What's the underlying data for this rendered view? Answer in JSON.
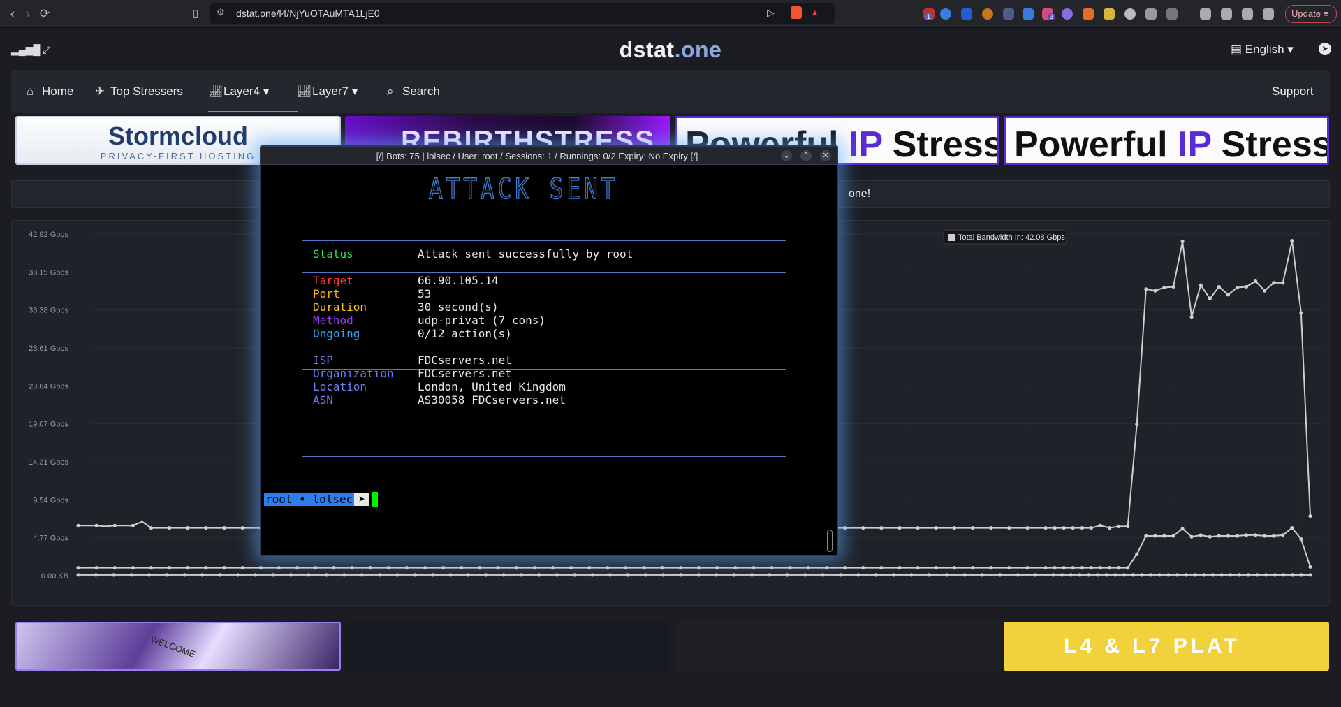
{
  "browser": {
    "url": "dstat.one/l4/NjYuOTAuMTA1LjE0",
    "update_label": "Update",
    "badge_a": "1",
    "badge_b": "3"
  },
  "site": {
    "logo_main": "dstat",
    "logo_accent": ".one",
    "language": "English",
    "nav": {
      "home": "Home",
      "top_stressers": "Top Stressers",
      "layer4": "Layer4",
      "layer7": "Layer7",
      "search": "Search",
      "support": "Support"
    },
    "notice_fragment": "one!"
  },
  "ads_top": {
    "stormcloud_title": "Stormcloud",
    "stormcloud_sub": "PRIVACY-FIRST HOSTING",
    "rebirth": "REBIRTHSTRESS",
    "powerful_1a": "Powerful ",
    "powerful_1b": "IP",
    "powerful_1c": " Stresser",
    "powerful_2a": "Powerful ",
    "powerful_2b": "IP",
    "powerful_2c": " Stresser"
  },
  "ads_bottom": {
    "welcome": "WELCOME",
    "platform": "L4 & L7 PLAT"
  },
  "chart_data": {
    "type": "line",
    "y_ticks": [
      "42.92 Gbps",
      "38.15 Gbps",
      "33.38 Gbps",
      "28.61 Gbps",
      "23.84 Gbps",
      "19.07 Gbps",
      "14.31 Gbps",
      "9.54 Gbps",
      "4.77 Gbps",
      "0.00 KB"
    ],
    "ylim": [
      0,
      42.92
    ],
    "y_unit": "Gbps",
    "tooltip": "Total Bandwidth In: 42.08 Gbps",
    "series": [
      {
        "name": "Total Bandwidth In",
        "color": "#cfcfcf",
        "values": [
          6.3,
          6.3,
          6.3,
          6.2,
          6.3,
          6.3,
          6.3,
          6.8,
          6.0,
          6.0,
          6.0,
          6.0,
          6.0,
          6.0,
          6.0,
          6.0,
          6.0,
          6.0,
          6.0,
          6.0,
          6.0,
          6.0,
          6.0,
          6.0,
          6.0,
          6.0,
          6.0,
          6.0,
          6.0,
          6.0,
          6.0,
          6.0,
          6.0,
          6.0,
          6.0,
          6.0,
          6.0,
          6.0,
          6.0,
          6.0,
          6.0,
          6.0,
          6.0,
          6.0,
          6.0,
          6.0,
          6.0,
          6.0,
          6.0,
          6.0,
          6.0,
          6.0,
          6.0,
          6.0,
          6.0,
          6.0,
          6.0,
          6.0,
          6.0,
          6.0,
          6.0,
          6.0,
          6.0,
          6.0,
          6.0,
          6.0,
          6.0,
          6.0,
          6.0,
          6.0,
          6.0,
          6.0,
          6.0,
          6.0,
          6.0,
          6.0,
          6.0,
          6.0,
          6.0,
          6.0,
          6.0,
          6.0,
          6.0,
          6.0,
          6.0,
          6.0,
          6.0,
          6.0,
          6.0,
          6.0,
          6.0,
          6.0,
          6.0,
          6.0,
          6.0,
          6.0,
          6.0,
          6.0,
          6.0,
          6.0,
          6.0,
          6.0,
          6.0,
          6.0,
          6.0,
          6.0,
          6.0,
          6.0,
          6.0,
          6.0,
          6.0,
          6.0,
          6.3,
          6.0,
          6.2,
          6.2,
          19.0,
          36.0,
          35.8,
          36.2,
          36.3,
          42.0,
          32.5,
          36.5,
          34.8,
          36.3,
          35.3,
          36.2,
          36.3,
          37.0,
          35.8,
          36.8,
          36.8,
          42.08,
          33.0,
          7.5
        ]
      },
      {
        "name": "",
        "color": "#cfcfcf",
        "values": [
          1.0,
          1.0,
          1.0,
          1.0,
          1.0,
          1.0,
          1.0,
          1.0,
          1.0,
          1.0,
          1.0,
          1.0,
          1.0,
          1.0,
          1.0,
          1.0,
          1.0,
          1.0,
          1.0,
          1.0,
          1.0,
          1.0,
          1.0,
          1.0,
          1.0,
          1.0,
          1.0,
          1.0,
          1.0,
          1.0,
          1.0,
          1.0,
          1.0,
          1.0,
          1.0,
          1.0,
          1.0,
          1.0,
          1.0,
          1.0,
          1.0,
          1.0,
          1.0,
          1.0,
          1.0,
          1.0,
          1.0,
          1.0,
          1.0,
          1.0,
          1.0,
          1.0,
          1.0,
          1.0,
          1.0,
          1.0,
          1.0,
          1.0,
          1.0,
          1.0,
          1.0,
          1.0,
          1.0,
          1.0,
          1.0,
          1.0,
          1.0,
          1.0,
          1.0,
          1.0,
          1.0,
          1.0,
          1.0,
          1.0,
          1.0,
          1.0,
          1.0,
          1.0,
          1.0,
          1.0,
          1.0,
          1.0,
          1.0,
          1.0,
          1.0,
          1.0,
          1.0,
          1.0,
          1.0,
          1.0,
          1.0,
          1.0,
          1.0,
          1.0,
          1.0,
          1.0,
          1.0,
          1.0,
          1.0,
          1.0,
          1.0,
          1.0,
          1.0,
          1.0,
          1.0,
          1.0,
          1.0,
          1.0,
          1.0,
          1.0,
          1.0,
          1.0,
          1.0,
          1.0,
          1.0,
          1.0,
          2.7,
          5.0,
          5.0,
          5.0,
          5.0,
          5.9,
          4.9,
          5.1,
          4.9,
          5.0,
          5.0,
          5.0,
          5.1,
          5.1,
          5.0,
          5.0,
          5.1,
          6.0,
          4.6,
          1.1
        ]
      },
      {
        "name": "",
        "color": "#cfcfcf",
        "values": [
          0.1,
          0.1,
          0.1,
          0.1,
          0.1,
          0.1,
          0.1,
          0.1,
          0.1,
          0.1,
          0.1,
          0.1,
          0.1,
          0.1,
          0.1,
          0.1,
          0.1,
          0.1,
          0.1,
          0.1,
          0.1,
          0.1,
          0.1,
          0.1,
          0.1,
          0.1,
          0.1,
          0.1,
          0.1,
          0.1,
          0.1,
          0.1,
          0.1,
          0.1,
          0.1,
          0.1,
          0.1,
          0.1,
          0.1,
          0.1,
          0.1,
          0.1,
          0.1,
          0.1,
          0.1,
          0.1,
          0.1,
          0.1,
          0.1,
          0.1,
          0.1,
          0.1,
          0.1,
          0.1,
          0.1,
          0.1,
          0.1,
          0.1,
          0.1,
          0.1,
          0.1,
          0.1,
          0.1,
          0.1,
          0.1,
          0.1,
          0.1,
          0.1,
          0.1,
          0.1,
          0.1,
          0.1,
          0.1,
          0.1,
          0.1,
          0.1,
          0.1,
          0.1,
          0.1,
          0.1,
          0.1,
          0.1,
          0.1,
          0.1,
          0.1,
          0.1,
          0.1,
          0.1,
          0.1,
          0.1,
          0.1,
          0.1,
          0.1,
          0.1,
          0.1,
          0.1,
          0.1,
          0.1,
          0.1,
          0.1,
          0.1,
          0.1,
          0.1,
          0.1,
          0.1,
          0.1,
          0.1,
          0.1,
          0.1,
          0.1,
          0.1,
          0.1,
          0.1,
          0.1,
          0.1,
          0.1,
          0.1,
          0.1,
          0.1,
          0.1,
          0.1,
          0.1,
          0.1,
          0.1,
          0.1,
          0.1,
          0.1,
          0.1,
          0.1,
          0.1,
          0.1,
          0.1,
          0.1,
          0.1,
          0.1,
          0.1,
          0.1,
          0.1,
          0.1,
          0.1
        ]
      }
    ]
  },
  "terminal": {
    "title": "[/] Bots: 75 | lolsec / User: root / Sessions: 1 / Runnings: 0/2 Expiry: No Expiry [/]",
    "banner": "ATTACK SENT",
    "rows": [
      {
        "key": "Status",
        "value": "Attack sent successfully by root",
        "color": "#2fe04a"
      },
      {
        "key": "Target",
        "value": "66.90.105.14",
        "color": "#ff3b3b"
      },
      {
        "key": "Port",
        "value": "53",
        "color": "#ffb21e"
      },
      {
        "key": "Duration",
        "value": "30 second(s)",
        "color": "#ffc21e"
      },
      {
        "key": "Method",
        "value": "udp-privat (7 cons)",
        "color": "#a23bff"
      },
      {
        "key": "Ongoing",
        "value": "0/12 action(s)",
        "color": "#2aa8ff"
      },
      {
        "key": "ISP",
        "value": "FDCservers.net",
        "color": "#6d7cf0"
      },
      {
        "key": "Organization",
        "value": "FDCservers.net",
        "color": "#6d7cf0"
      },
      {
        "key": "Location",
        "value": "London, United Kingdom",
        "color": "#6d7cf0"
      },
      {
        "key": "ASN",
        "value": "AS30058 FDCservers.net",
        "color": "#6d7cf0"
      }
    ],
    "prompt_user": "root • lolsec",
    "prompt_arrow": "➤"
  }
}
